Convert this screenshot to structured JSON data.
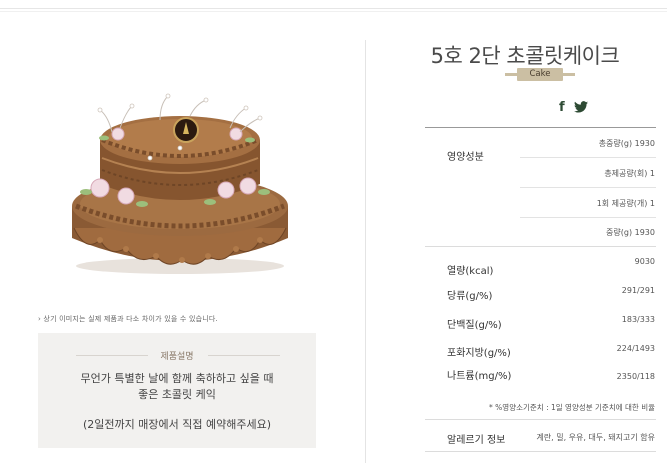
{
  "image_notice": "› 상기 이미지는 실제 제품과 다소 차이가 있을 수 있습니다.",
  "description": {
    "title": "제품설명",
    "main_lines": [
      "무언가 특별한 날에 함께 축하하고 싶을 때",
      "좋은 초콜릿 케익"
    ],
    "note": "(2일전까지 매장에서 직접 예약해주세요)"
  },
  "product": {
    "title": "5호 2단 초콜릿케이크",
    "subtitle": "Cake"
  },
  "social": {
    "facebook_icon": "f",
    "twitter_icon": "twitter-bird"
  },
  "nutrition": {
    "section_label": "영양성분",
    "serving_rows": [
      "총중량(g) 1930",
      "총제공량(회) 1",
      "1회 제공량(개) 1",
      "중량(g) 1930"
    ],
    "items": [
      {
        "label": "열량(kcal)",
        "value": "9030"
      },
      {
        "label": "당류(g/%)",
        "value": "291/291"
      },
      {
        "label": "단백질(g/%)",
        "value": "183/333"
      },
      {
        "label": "포화지방(g/%)",
        "value": "224/1493"
      },
      {
        "label": "나트륨(mg/%)",
        "value": "2350/118"
      }
    ],
    "footnote": "* %영양소기준치 : 1일 영양성분 기준치에 대한 비율"
  },
  "allergy": {
    "label": "알레르기 정보",
    "value": "계란, 밀, 우유, 대두, 돼지고기 함유"
  },
  "colors": {
    "ribbon": "#cbbfa3",
    "cake_brown": "#8a5a34",
    "social_green": "#2d4a33"
  }
}
